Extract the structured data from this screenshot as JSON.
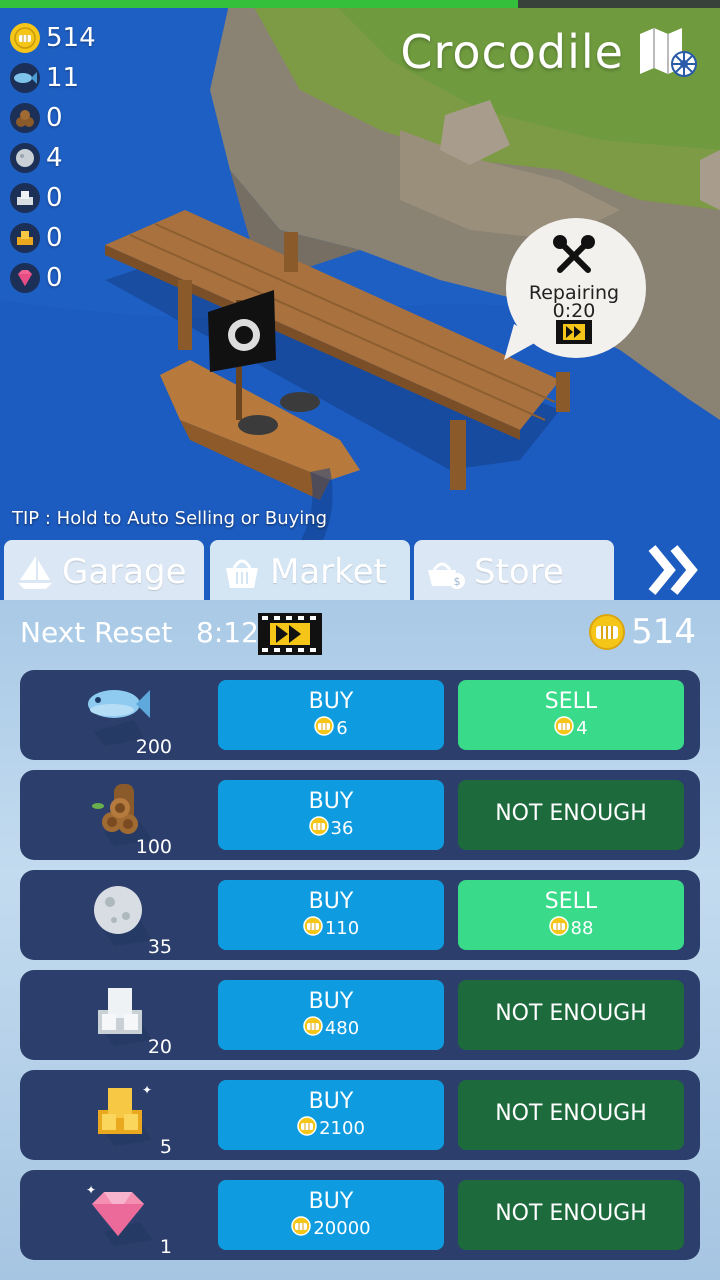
{
  "hud": {
    "progress": 0.72,
    "resources": [
      {
        "icon": "coin-icon",
        "value": "514"
      },
      {
        "icon": "fish-icon",
        "value": "11"
      },
      {
        "icon": "wood-icon",
        "value": "0"
      },
      {
        "icon": "stone-icon",
        "value": "4"
      },
      {
        "icon": "silver-icon",
        "value": "0"
      },
      {
        "icon": "gold-icon",
        "value": "0"
      },
      {
        "icon": "gem-icon",
        "value": "0"
      }
    ],
    "location": "Crocodile"
  },
  "repair": {
    "label": "Repairing",
    "time": "0:20"
  },
  "tip": "TIP : Hold to Auto Selling or Buying",
  "tabs": [
    {
      "name": "garage",
      "label": "Garage"
    },
    {
      "name": "market",
      "label": "Market"
    },
    {
      "name": "store",
      "label": "Store"
    }
  ],
  "market": {
    "reset_label": "Next Reset",
    "reset_time": "8:12",
    "coins": "514",
    "items": [
      {
        "item": "fish",
        "qty": "200",
        "buy_label": "BUY",
        "buy_price": "6",
        "sell_label": "SELL",
        "sell_price": "4",
        "can_sell": true
      },
      {
        "item": "wood",
        "qty": "100",
        "buy_label": "BUY",
        "buy_price": "36",
        "sell_label": "NOT ENOUGH",
        "sell_price": "",
        "can_sell": false
      },
      {
        "item": "stone",
        "qty": "35",
        "buy_label": "BUY",
        "buy_price": "110",
        "sell_label": "SELL",
        "sell_price": "88",
        "can_sell": true
      },
      {
        "item": "silver",
        "qty": "20",
        "buy_label": "BUY",
        "buy_price": "480",
        "sell_label": "NOT ENOUGH",
        "sell_price": "",
        "can_sell": false
      },
      {
        "item": "gold",
        "qty": "5",
        "buy_label": "BUY",
        "buy_price": "2100",
        "sell_label": "NOT ENOUGH",
        "sell_price": "",
        "can_sell": false
      },
      {
        "item": "gem",
        "qty": "1",
        "buy_label": "BUY",
        "buy_price": "20000",
        "sell_label": "NOT ENOUGH",
        "sell_price": "",
        "can_sell": false
      }
    ]
  },
  "colors": {
    "buy": "#0e9be0",
    "sell": "#39da8a",
    "not_enough": "#1d6a3d",
    "row_bg": "#2c3e6b",
    "coin": "#f5c518"
  }
}
